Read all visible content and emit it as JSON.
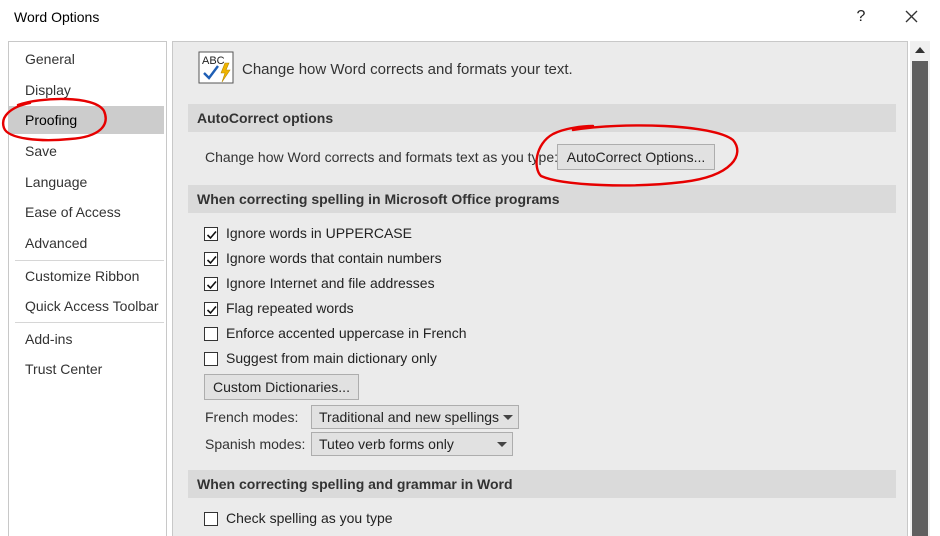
{
  "window": {
    "title": "Word Options",
    "help_label": "?",
    "close_icon": "close-icon"
  },
  "sidebar": {
    "items": [
      {
        "label": "General"
      },
      {
        "label": "Display"
      },
      {
        "label": "Proofing",
        "selected": true
      },
      {
        "label": "Save"
      },
      {
        "label": "Language"
      },
      {
        "label": "Ease of Access"
      },
      {
        "label": "Advanced"
      },
      {
        "label": "Customize Ribbon"
      },
      {
        "label": "Quick Access Toolbar"
      },
      {
        "label": "Add-ins"
      },
      {
        "label": "Trust Center"
      }
    ]
  },
  "main": {
    "header": {
      "icon_text": "ABC",
      "icon": "abc-check-icon",
      "text": "Change how Word corrects and formats your text."
    },
    "autocorrect": {
      "section_title": "AutoCorrect options",
      "label": "Change how Word corrects and formats text as you type:",
      "button_label": "AutoCorrect Options..."
    },
    "spelling_office": {
      "section_title": "When correcting spelling in Microsoft Office programs",
      "options": [
        {
          "label": "Ignore words in UPPERCASE",
          "checked": true
        },
        {
          "label": "Ignore words that contain numbers",
          "checked": true
        },
        {
          "label": "Ignore Internet and file addresses",
          "checked": true
        },
        {
          "label": "Flag repeated words",
          "checked": true
        },
        {
          "label": "Enforce accented uppercase in French",
          "checked": false
        },
        {
          "label": "Suggest from main dictionary only",
          "checked": false
        }
      ],
      "custom_dictionaries_label": "Custom Dictionaries...",
      "french_modes_label": "French modes:",
      "french_modes_value": "Traditional and new spellings",
      "spanish_modes_label": "Spanish modes:",
      "spanish_modes_value": "Tuteo verb forms only"
    },
    "spelling_word": {
      "section_title": "When correcting spelling and grammar in Word",
      "options": [
        {
          "label": "Check spelling as you type",
          "checked": false
        }
      ]
    }
  },
  "colors": {
    "annotation": "#e60000",
    "selected_nav": "#cccccc",
    "section_bar": "#dadada",
    "panel_bg": "#ebebeb"
  }
}
